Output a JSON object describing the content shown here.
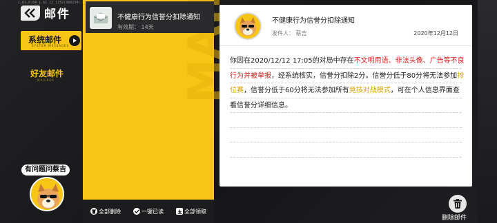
{
  "debug_line": "1.61.0.64 1.61.12.1252(360234) ░ 0000000000 ░░ ░ 1617176d17",
  "header": {
    "title": "邮件"
  },
  "tabs": [
    {
      "label": "系统邮件",
      "sub": "SYSTEM MESSAGES",
      "active": true
    },
    {
      "label": "好友邮件",
      "sub": "MAILBOX",
      "active": false
    }
  ],
  "help": {
    "label": "有问题问蔡吉"
  },
  "mail_list": [
    {
      "title": "不健康行为信誉分扣除通知",
      "expiry_label": "有效期：",
      "expiry_value": "14天"
    }
  ],
  "list_actions": {
    "delete_all": "全部删除",
    "read_all": "一键已读",
    "claim_all": "全部领取"
  },
  "watermark": "MAIL",
  "detail": {
    "title": "不健康行为信誉分扣除通知",
    "sender_label": "发件人：",
    "sender_name": "蔡吉",
    "date": "2020年12月12日",
    "body": {
      "p1": "你因在2020/12/12 17:05的对局中存在",
      "red1": "不文明用语、非法头像、广告等不良行为并被举报",
      "p2": "，经系统核实，信誉分扣除2分。信誉分低于80分将无法参加",
      "ylw1": "排位赛",
      "p3": "，信誉分低于60分将无法参加所有",
      "ylw2": "竞技对战模式",
      "p4": "，可在个人信息界面查看信誉分详细信息。"
    }
  },
  "delete_button": {
    "label": "删除邮件"
  },
  "colors": {
    "accent": "#f6c516",
    "warning_red": "#e02121"
  }
}
